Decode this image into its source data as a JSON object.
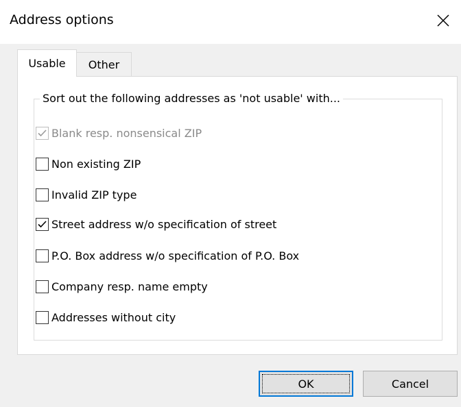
{
  "window": {
    "title": "Address options",
    "close_icon": "close-icon"
  },
  "tabs": [
    {
      "label": "Usable",
      "selected": true
    },
    {
      "label": "Other",
      "selected": false
    }
  ],
  "group": {
    "legend": "Sort out the following addresses as 'not usable' with..."
  },
  "options": [
    {
      "label": "Blank resp. nonsensical ZIP",
      "checked": true,
      "enabled": false
    },
    {
      "label": "Non existing ZIP",
      "checked": false,
      "enabled": true
    },
    {
      "label": "Invalid ZIP type",
      "checked": false,
      "enabled": true
    },
    {
      "label": "Street address w/o specification of street",
      "checked": true,
      "enabled": true
    },
    {
      "label": "P.O. Box address w/o specification of P.O. Box",
      "checked": false,
      "enabled": true
    },
    {
      "label": "Company resp. name empty",
      "checked": false,
      "enabled": true
    },
    {
      "label": "Addresses without city",
      "checked": false,
      "enabled": true
    }
  ],
  "buttons": {
    "ok": "OK",
    "cancel": "Cancel"
  },
  "colors": {
    "focus_accent": "#0078d7",
    "disabled_text": "#8a8a8a"
  }
}
